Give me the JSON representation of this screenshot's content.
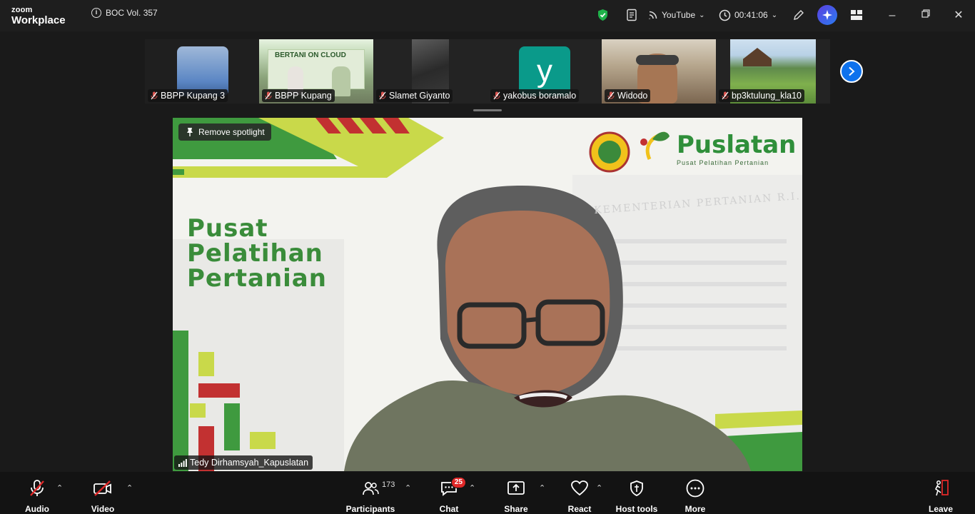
{
  "app": {
    "logo_top": "zoom",
    "logo_bottom": "Workplace"
  },
  "meeting": {
    "title": "BOC Vol. 357"
  },
  "titlebar": {
    "stream_label": "YouTube",
    "timer": "00:41:06"
  },
  "participants_strip": [
    {
      "name": "BBPP Kupang 3",
      "muted": true
    },
    {
      "name": "BBPP Kupang",
      "muted": true
    },
    {
      "name": "Slamet Giyanto",
      "muted": true
    },
    {
      "name": "yakobus boramalo",
      "muted": true,
      "avatar_letter": "y"
    },
    {
      "name": "Widodo",
      "muted": true
    },
    {
      "name": "bp3ktulung_kla10",
      "muted": true
    }
  ],
  "spotlight": {
    "remove_label": "Remove spotlight",
    "speaker_name": "Tedy Dirhamsyah_Kapuslatan",
    "bg_title_lines": [
      "Pusat",
      "Pelatihan",
      "Pertanian"
    ],
    "brand": "Puslatan",
    "brand_sub": "Pusat Pelatihan Pertanian",
    "building_sign": "KEMENTERIAN PERTANIAN R.I."
  },
  "toolbar": {
    "audio": "Audio",
    "video": "Video",
    "participants": "Participants",
    "participants_count": "173",
    "chat": "Chat",
    "chat_badge": "25",
    "share": "Share",
    "react": "React",
    "host_tools": "Host tools",
    "more": "More",
    "leave": "Leave"
  },
  "colors": {
    "accent": "#0e72ed",
    "muted_red": "#e02828",
    "brand_green": "#2f8f3a"
  }
}
